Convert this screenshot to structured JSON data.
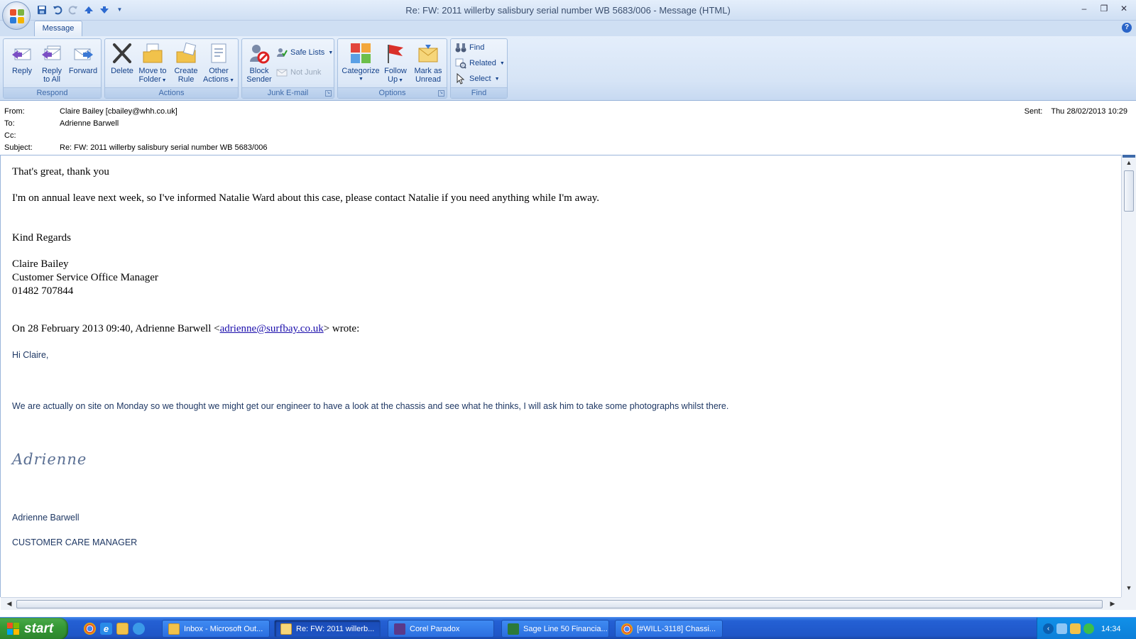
{
  "window": {
    "title": "Re: FW: 2011 willerby salisbury serial number WB 5683/006 - Message (HTML)",
    "controls": [
      "minimize",
      "restore",
      "close"
    ]
  },
  "qat": {
    "items": [
      "save-icon",
      "undo-icon",
      "redo-icon",
      "previous-item-icon",
      "next-item-icon",
      "customize-dropdown-icon"
    ]
  },
  "ribbon": {
    "tab": "Message",
    "groups": {
      "respond": {
        "label": "Respond",
        "reply": "Reply",
        "reply_all_1": "Reply",
        "reply_all_2": "to All",
        "forward": "Forward"
      },
      "actions": {
        "label": "Actions",
        "delete": "Delete",
        "move_1": "Move to",
        "move_2": "Folder",
        "create_1": "Create",
        "create_2": "Rule",
        "other_1": "Other",
        "other_2": "Actions"
      },
      "junk": {
        "label": "Junk E-mail",
        "block_1": "Block",
        "block_2": "Sender",
        "safe_lists": "Safe Lists",
        "not_junk": "Not Junk"
      },
      "options": {
        "label": "Options",
        "categorize": "Categorize",
        "follow_1": "Follow",
        "follow_2": "Up",
        "mark_1": "Mark as",
        "mark_2": "Unread"
      },
      "find": {
        "label": "Find",
        "find": "Find",
        "related": "Related",
        "select": "Select"
      }
    }
  },
  "header": {
    "from_label": "From:",
    "from_value": "Claire Bailey [cbailey@whh.co.uk]",
    "to_label": "To:",
    "to_value": "Adrienne Barwell",
    "cc_label": "Cc:",
    "cc_value": "",
    "subject_label": "Subject:",
    "subject_value": "Re: FW: 2011 willerby salisbury serial number WB 5683/006",
    "sent_label": "Sent:",
    "sent_value": "Thu 28/02/2013 10:29"
  },
  "body": {
    "line1": "That's great, thank you",
    "line2": "I'm on annual leave next week, so I've informed Natalie Ward about this case, please contact Natalie if you need anything while I'm away.",
    "regards": "Kind Regards",
    "sig_name": "Claire Bailey",
    "sig_title": "Customer Service Office Manager",
    "sig_phone": "01482 707844",
    "quote_prefix": "On 28 February 2013 09:40, Adrienne Barwell <",
    "quote_email": "adrienne@surfbay.co.uk",
    "quote_suffix": "> wrote:",
    "greeting": "Hi Claire,",
    "quoted_text": "We are actually on site on Monday so we thought we might get our engineer to have a look at the chassis and see what he thinks, I will ask him to take some photographs whilst there.",
    "script_signature": "Adrienne",
    "quoted_name": "Adrienne Barwell",
    "quoted_title": "CUSTOMER CARE MANAGER"
  },
  "taskbar": {
    "start": "start",
    "tasks": [
      {
        "label": "Inbox - Microsoft Out...",
        "icon": "outlook-icon",
        "active": false
      },
      {
        "label": "Re: FW: 2011 willerb...",
        "icon": "mail-message-icon",
        "active": true
      },
      {
        "label": "Corel Paradox",
        "icon": "paradox-icon",
        "active": false
      },
      {
        "label": "Sage Line 50 Financia...",
        "icon": "sage-icon",
        "active": false
      },
      {
        "label": "[#WILL-3118] Chassi...",
        "icon": "chrome-icon",
        "active": false
      }
    ],
    "clock": "14:34"
  },
  "colors": {
    "ribbon_text": "#15428b",
    "quoted_text": "#1f3864",
    "taskbar": "#2460d4",
    "start_button": "#369a36",
    "link": "#1a0dab"
  }
}
